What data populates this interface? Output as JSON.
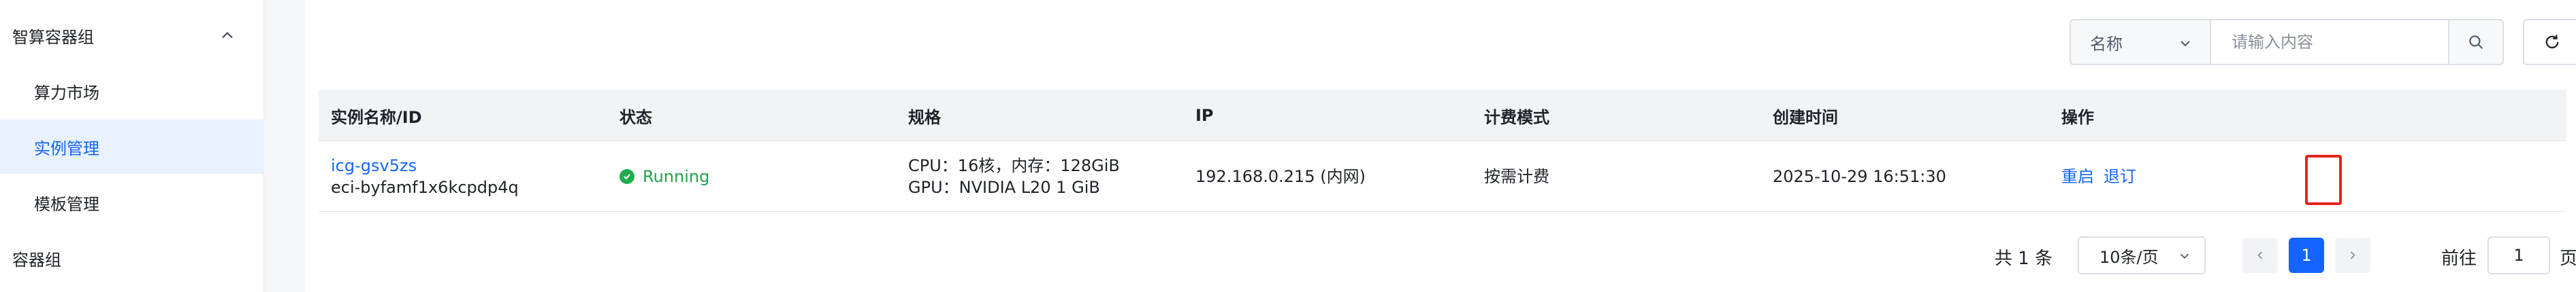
{
  "sidebar": {
    "group1": "智算容器组",
    "items": [
      {
        "label": "算力市场"
      },
      {
        "label": "实例管理"
      },
      {
        "label": "模板管理"
      }
    ],
    "group2": "容器组"
  },
  "toolbar": {
    "filter_selected": "名称",
    "search_placeholder": "请输入内容"
  },
  "table": {
    "headers": [
      "实例名称/ID",
      "状态",
      "规格",
      "IP",
      "计费模式",
      "创建时间",
      "操作"
    ],
    "rows": [
      {
        "name": "icg-gsv5zs",
        "id": "eci-byfamf1x6kcpdp4q",
        "status": "Running",
        "spec_line1": "CPU：16核，内存：128GiB",
        "spec_line2": "GPU：NVIDIA L20 1 GiB",
        "ip": "192.168.0.215 (内网)",
        "billing": "按需计费",
        "created": "2025-10-29 16:51:30",
        "op_restart": "重启",
        "op_unsubscribe": "退订"
      }
    ]
  },
  "pagination": {
    "total": "共 1 条",
    "page_size": "10条/页",
    "current_page": "1",
    "goto_label": "前往",
    "goto_value": "1",
    "goto_suffix": "页"
  },
  "colors": {
    "accent": "#1664ff",
    "running": "#1fae4f",
    "annotation": "#e5241b"
  }
}
